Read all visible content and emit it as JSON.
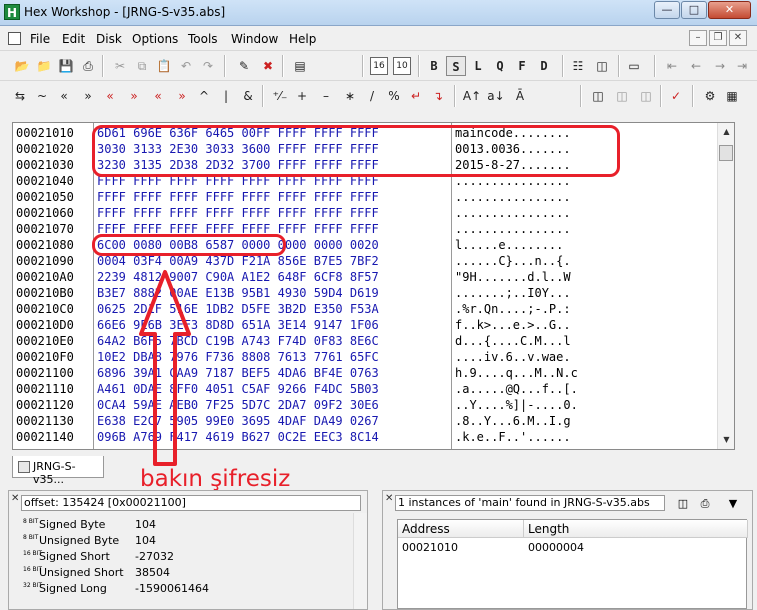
{
  "window": {
    "title": "Hex Workshop - [JRNG-S-v35.abs]",
    "app_icon": "H"
  },
  "menu": [
    "File",
    "Edit",
    "Disk",
    "Options",
    "Tools",
    "Window",
    "Help"
  ],
  "toolbar2_text": {
    "t_16": "16",
    "t_10": "10",
    "b": "B",
    "s": "S",
    "l": "L",
    "q": "Q",
    "f": "F",
    "d": "D"
  },
  "hex": {
    "rows": [
      {
        "addr": "00021010",
        "hex": "6D61 696E 636F 6465 00FF FFFF FFFF FFFF",
        "ascii": "maincode........"
      },
      {
        "addr": "00021020",
        "hex": "3030 3133 2E30 3033 3600 FFFF FFFF FFFF",
        "ascii": "0013.0036......."
      },
      {
        "addr": "00021030",
        "hex": "3230 3135 2D38 2D32 3700 FFFF FFFF FFFF",
        "ascii": "2015-8-27......."
      },
      {
        "addr": "00021040",
        "hex": "FFFF FFFF FFFF FFFF FFFF FFFF FFFF FFFF",
        "ascii": "................"
      },
      {
        "addr": "00021050",
        "hex": "FFFF FFFF FFFF FFFF FFFF FFFF FFFF FFFF",
        "ascii": "................"
      },
      {
        "addr": "00021060",
        "hex": "FFFF FFFF FFFF FFFF FFFF FFFF FFFF FFFF",
        "ascii": "................"
      },
      {
        "addr": "00021070",
        "hex": "FFFF FFFF FFFF FFFF FFFF FFFF FFFF FFFF",
        "ascii": "................"
      },
      {
        "addr": "00021080",
        "hex": "6C00 0080 00B8 6587 0000 0000 0000 0020",
        "ascii": "l.....e........ "
      },
      {
        "addr": "00021090",
        "hex": "0004 03F4 00A9 437D F21A 856E B7E5 7BF2",
        "ascii": "......C}...n..{."
      },
      {
        "addr": "000210A0",
        "hex": "2239 4812 9007 C90A A1E2 648F 6CF8 8F57",
        "ascii": "\"9H.......d.l..W"
      },
      {
        "addr": "000210B0",
        "hex": "B3E7 8882 00AE E13B 95B1 4930 59D4 D619",
        "ascii": ".......;..I0Y..."
      },
      {
        "addr": "000210C0",
        "hex": "0625 2D1F 516E 1DB2 D5FE 3B2D E350 F53A",
        "ascii": ".%r.Qn....;-.P.:"
      },
      {
        "addr": "000210D0",
        "hex": "66E6 9E6B 3EF3 8D8D 651A 3E14 9147 1F06",
        "ascii": "f..k>...e.>..G.."
      },
      {
        "addr": "000210E0",
        "hex": "64A2 B6F5 7BCD C19B A743 F74D 0F83 8E6C",
        "ascii": "d...{....C.M...l"
      },
      {
        "addr": "000210F0",
        "hex": "10E2 DBA8 7976 F736 8808 7613 7761 65FC",
        "ascii": "....iv.6..v.wae."
      },
      {
        "addr": "00021100",
        "hex": "6896 39A1 CAA9 7187 BEF5 4DA6 BF4E 0763",
        "ascii": "h.9....q...M..N.c"
      },
      {
        "addr": "00021110",
        "hex": "A461 0DAE 8FF0 4051 C5AF 9266 F4DC 5B03",
        "ascii": ".a.....@Q...f..[."
      },
      {
        "addr": "00021120",
        "hex": "0CA4 59AE AEB0 7F25 5D7C 2DA7 09F2 30E6",
        "ascii": "..Y....%]|-....0."
      },
      {
        "addr": "00021130",
        "hex": "E638 E2C7 5905 99E0 3695 4DAF DA49 0267",
        "ascii": ".8..Y...6.M..I.g"
      },
      {
        "addr": "00021140",
        "hex": "096B A769 F417 4619 B627 0C2E EEC3 8C14",
        "ascii": ".k.e..F..'......"
      }
    ]
  },
  "doc_tab": "JRNG-S-v35...",
  "annotation": "bakın şifresiz",
  "data_inspector": {
    "offset": "offset: 135424 [0x00021100]",
    "rows": [
      {
        "bits": "8 BIT",
        "label": "Signed Byte",
        "value": "104"
      },
      {
        "bits": "8 BIT",
        "label": "Unsigned Byte",
        "value": "104"
      },
      {
        "bits": "16 BIT",
        "label": "Signed Short",
        "value": "-27032"
      },
      {
        "bits": "16 BIT",
        "label": "Unsigned Short",
        "value": "38504"
      },
      {
        "bits": "32 BIT",
        "label": "Signed Long",
        "value": "-1590061464"
      }
    ]
  },
  "find_results": {
    "summary": "1 instances of 'main' found in JRNG-S-v35.abs",
    "columns": [
      "Address",
      "Length"
    ],
    "rows": [
      {
        "address": "00021010",
        "length": "00000004"
      }
    ]
  },
  "colors": {
    "annotation_red": "#e8202a",
    "hex_blue": "#1818b0"
  }
}
